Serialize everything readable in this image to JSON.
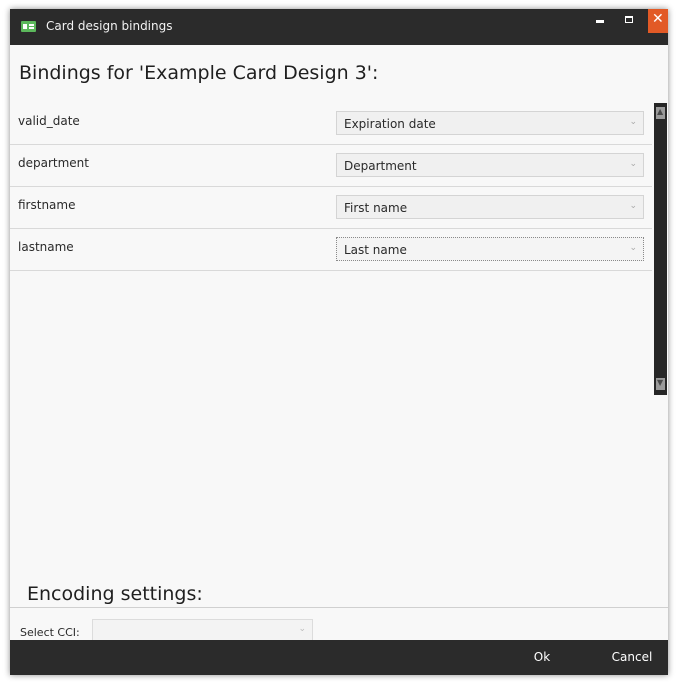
{
  "window": {
    "title": "Card design bindings"
  },
  "header": {
    "title": "Bindings for 'Example Card Design 3':"
  },
  "bindings": [
    {
      "field": "valid_date",
      "value": "Expiration date"
    },
    {
      "field": "department",
      "value": "Department"
    },
    {
      "field": "firstname",
      "value": "First name"
    },
    {
      "field": "lastname",
      "value": "Last name"
    }
  ],
  "encoding": {
    "title": "Encoding settings:",
    "cci_label": "Select CCI:",
    "cci_value": ""
  },
  "footer": {
    "ok_label": "Ok",
    "cancel_label": "Cancel"
  },
  "icons": {
    "app": "card-icon",
    "minimize": "minimize-icon",
    "maximize": "maximize-icon",
    "close": "close-icon",
    "dropdown": "chevron-down-icon"
  },
  "colors": {
    "titlebar": "#2b2b2b",
    "close_button": "#e25a26",
    "app_icon": "#5cb85c",
    "content_bg": "#f8f8f8"
  }
}
